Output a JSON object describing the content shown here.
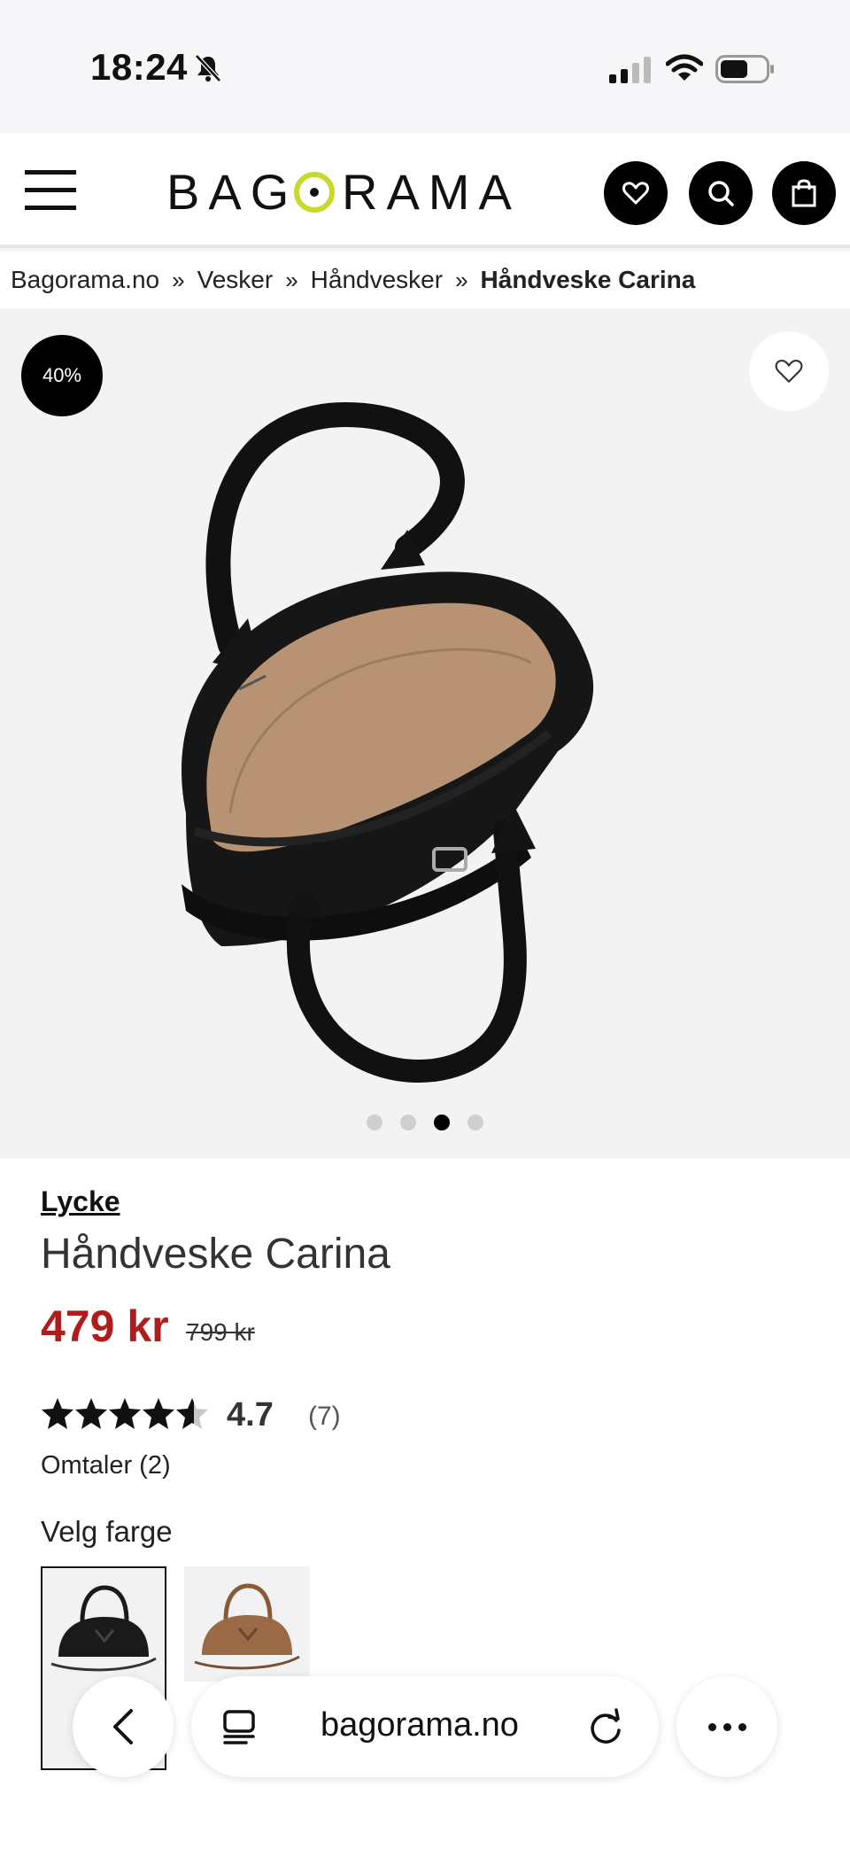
{
  "status_bar": {
    "time": "18:24"
  },
  "header": {
    "logo_text": "BAGORAMA",
    "logo_accent": "#c7d92c"
  },
  "breadcrumb": [
    {
      "label": "Bagorama.no"
    },
    {
      "label": "Vesker"
    },
    {
      "label": "Håndvesker"
    },
    {
      "label": "Håndveske Carina"
    }
  ],
  "breadcrumb_separator": "»",
  "gallery": {
    "discount_badge": "40%",
    "image_count": 4,
    "active_index": 2
  },
  "product": {
    "brand": "Lycke",
    "title": "Håndveske Carina",
    "price": "479 kr",
    "old_price": "799 kr",
    "price_color": "#b01c1c",
    "rating": "4.7",
    "rating_value": 4.7,
    "rating_count": "(7)",
    "reviews_label": "Omtaler (2)",
    "color_label": "Velg farge",
    "colors": [
      {
        "name": "black",
        "hex": "#1a1a1a",
        "selected": true
      },
      {
        "name": "brown",
        "hex": "#9a6a46",
        "selected": false
      }
    ]
  },
  "browser": {
    "url": "bagorama.no"
  }
}
